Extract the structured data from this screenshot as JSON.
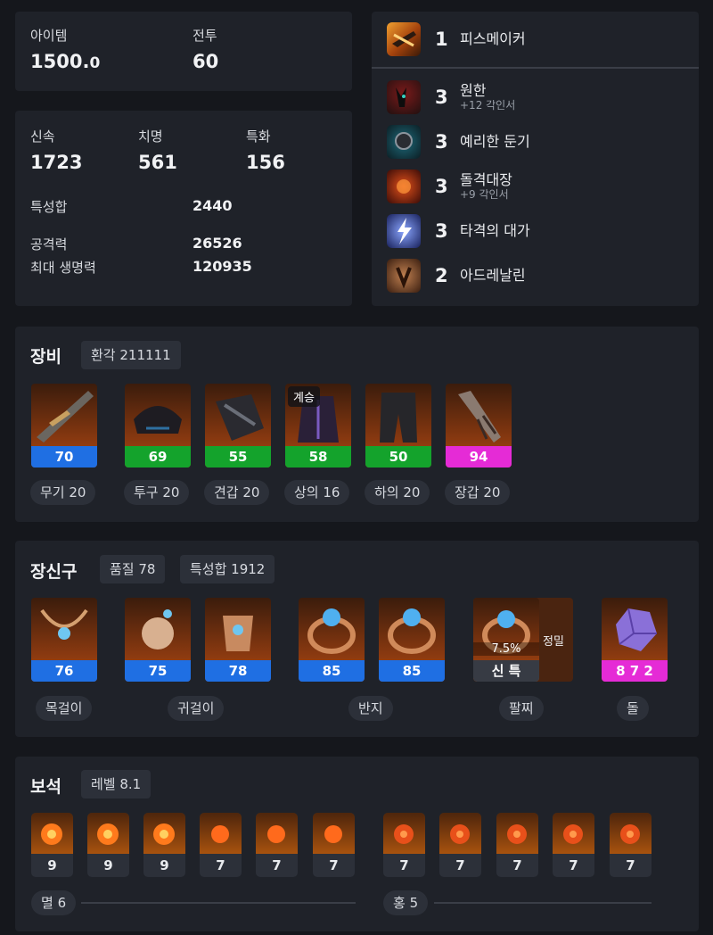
{
  "summary": {
    "item_label": "아이템",
    "item_value_main": "1500.",
    "item_value_dec": "0",
    "combat_label": "전투",
    "combat_value": "60"
  },
  "stats": {
    "swift_label": "신속",
    "swift_value": "1723",
    "crit_label": "치명",
    "crit_value": "561",
    "spec_label": "특화",
    "spec_value": "156",
    "total_label": "특성합",
    "total_value": "2440",
    "atk_label": "공격력",
    "atk_value": "26526",
    "hp_label": "최대 생명력",
    "hp_value": "120935"
  },
  "class_engraving": {
    "level": "1",
    "name": "피스메이커",
    "icon": "gun-icon"
  },
  "engravings": [
    {
      "level": "3",
      "name": "원한",
      "sub": "+12 각인서",
      "icon": "demon-icon"
    },
    {
      "level": "3",
      "name": "예리한 둔기",
      "sub": "",
      "icon": "mace-icon"
    },
    {
      "level": "3",
      "name": "돌격대장",
      "sub": "+9 각인서",
      "icon": "charge-icon"
    },
    {
      "level": "3",
      "name": "타격의 대가",
      "sub": "",
      "icon": "lightning-icon"
    },
    {
      "level": "2",
      "name": "아드레날린",
      "sub": "",
      "icon": "adrenaline-icon"
    }
  ],
  "equipment": {
    "title": "장비",
    "transcend_chip": "환각 211111",
    "items": [
      {
        "quality": "70",
        "label": "무기 20",
        "color": "#1f6fe3",
        "icon": "weapon-icon",
        "badge": ""
      },
      {
        "quality": "69",
        "label": "투구 20",
        "color": "#14a32c",
        "icon": "helmet-icon",
        "badge": ""
      },
      {
        "quality": "55",
        "label": "견갑 20",
        "color": "#14a32c",
        "icon": "shoulder-icon",
        "badge": ""
      },
      {
        "quality": "58",
        "label": "상의 16",
        "color": "#14a32c",
        "icon": "chest-icon",
        "badge": "계승"
      },
      {
        "quality": "50",
        "label": "하의 20",
        "color": "#14a32c",
        "icon": "pants-icon",
        "badge": ""
      },
      {
        "quality": "94",
        "label": "장갑 20",
        "color": "#e52bd6",
        "icon": "gloves-icon",
        "badge": ""
      }
    ]
  },
  "accessories": {
    "title": "장신구",
    "quality_chip": "품질 78",
    "stat_chip": "특성합 1912",
    "items": [
      {
        "quality": "76",
        "icon": "necklace-icon"
      },
      {
        "quality": "75",
        "icon": "earring-icon"
      },
      {
        "quality": "78",
        "icon": "earring-icon"
      },
      {
        "quality": "85",
        "icon": "ring-icon"
      },
      {
        "quality": "85",
        "icon": "ring-icon"
      }
    ],
    "labels": {
      "necklace": "목걸이",
      "earring": "귀걸이",
      "ring": "반지",
      "bracelet": "팔찌",
      "stone": "돌"
    },
    "bracelet": {
      "percent": "7.5%",
      "stats": "신 특",
      "grade": "정밀",
      "icon": "bracelet-icon"
    },
    "stone": {
      "value": "8 7 2",
      "icon": "stone-icon"
    }
  },
  "gems": {
    "title": "보석",
    "level_chip": "레벨 8.1",
    "left_levels": [
      "9",
      "9",
      "9",
      "7",
      "7",
      "7"
    ],
    "right_levels": [
      "7",
      "7",
      "7",
      "7",
      "7"
    ],
    "left_label": "멸 6",
    "right_label": "홍 5"
  }
}
